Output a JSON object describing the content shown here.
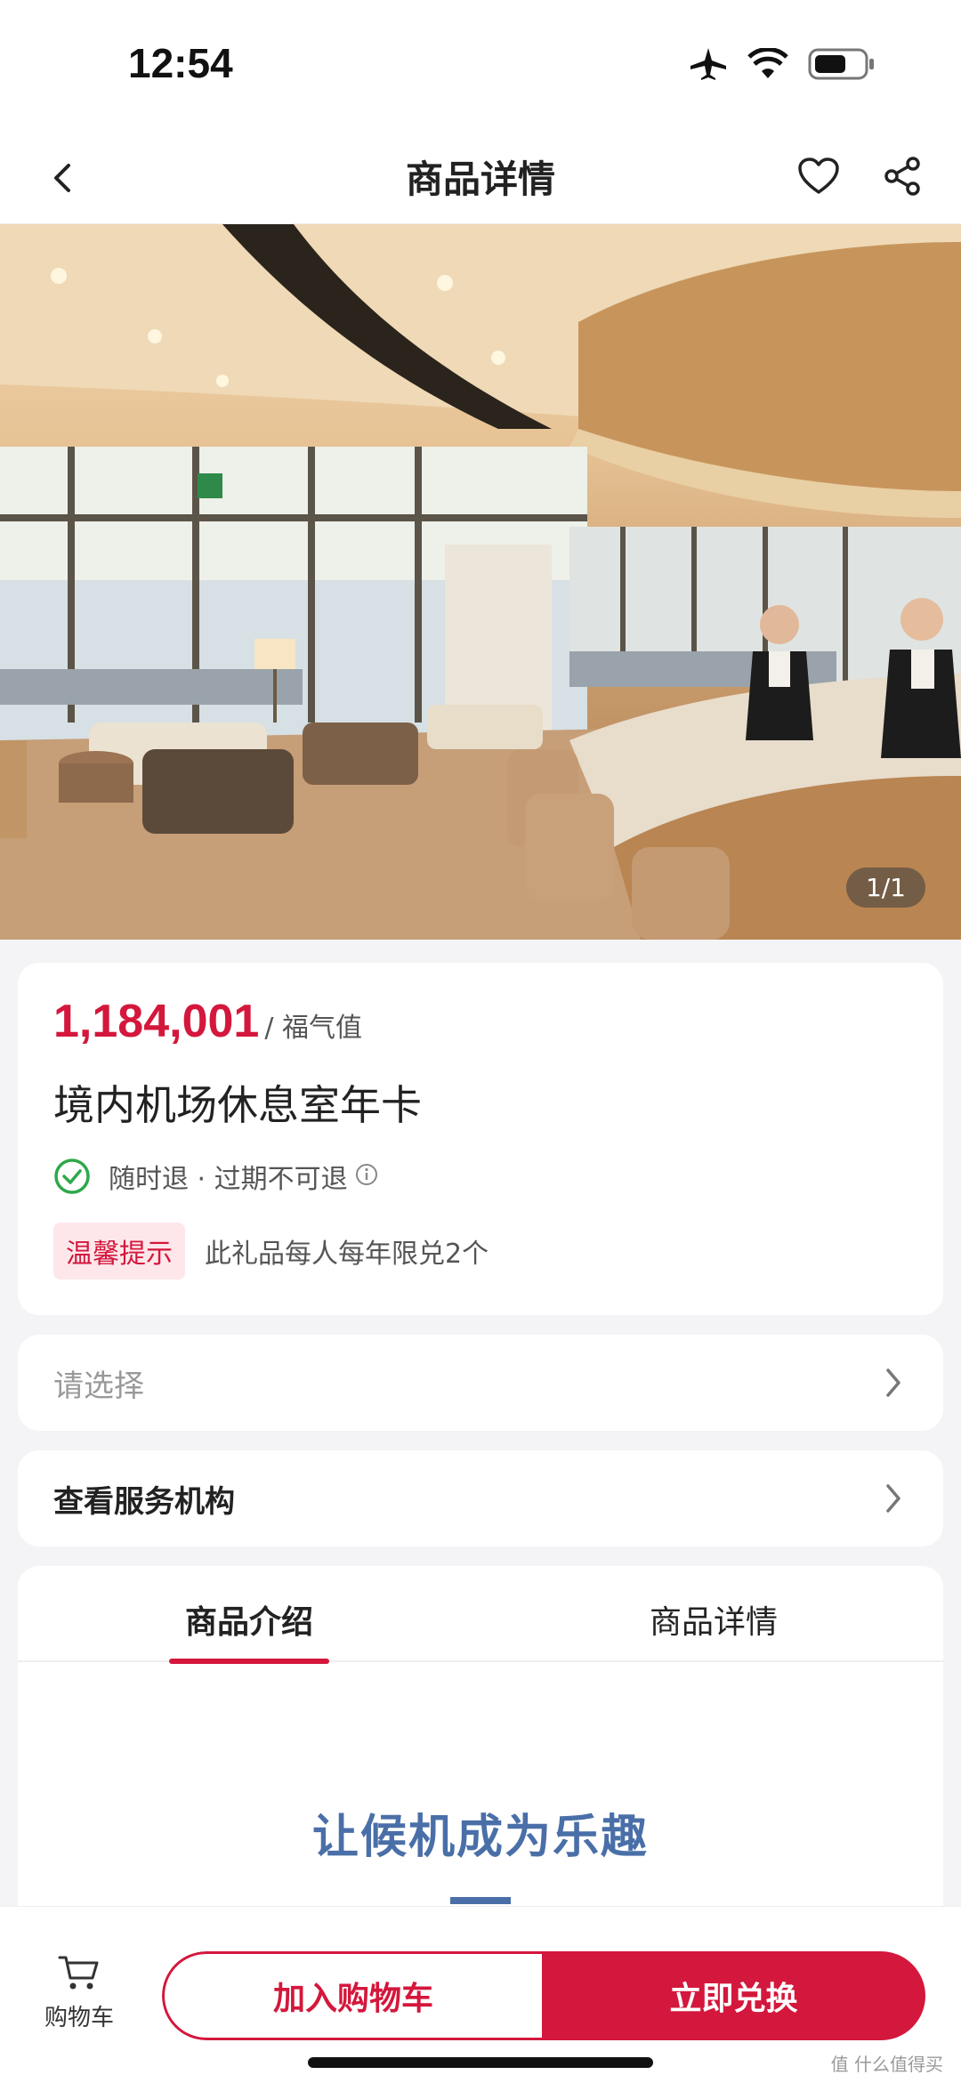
{
  "status_bar": {
    "time": "12:54"
  },
  "nav": {
    "title": "商品详情"
  },
  "hero": {
    "counter": "1/1"
  },
  "product": {
    "price": "1,184,001",
    "price_unit": "/ 福气值",
    "title": "境内机场休息室年卡",
    "refund_text": "随时退 · 过期不可退",
    "tip_badge": "温馨提示",
    "tip_text": "此礼品每人每年限兑2个"
  },
  "rows": {
    "select_label": "请选择",
    "service_label": "查看服务机构"
  },
  "tabs": [
    {
      "label": "商品介绍",
      "active": true
    },
    {
      "label": "商品详情",
      "active": false
    }
  ],
  "intro": {
    "heading": "让候机成为乐趣"
  },
  "bottom": {
    "cart_label": "购物车",
    "add_to_cart": "加入购物车",
    "redeem": "立即兑换"
  },
  "watermark": "值 什么值得买",
  "colors": {
    "accent": "#d4173c",
    "intro_blue": "#4a6fa8",
    "check_green": "#2ea84a"
  }
}
